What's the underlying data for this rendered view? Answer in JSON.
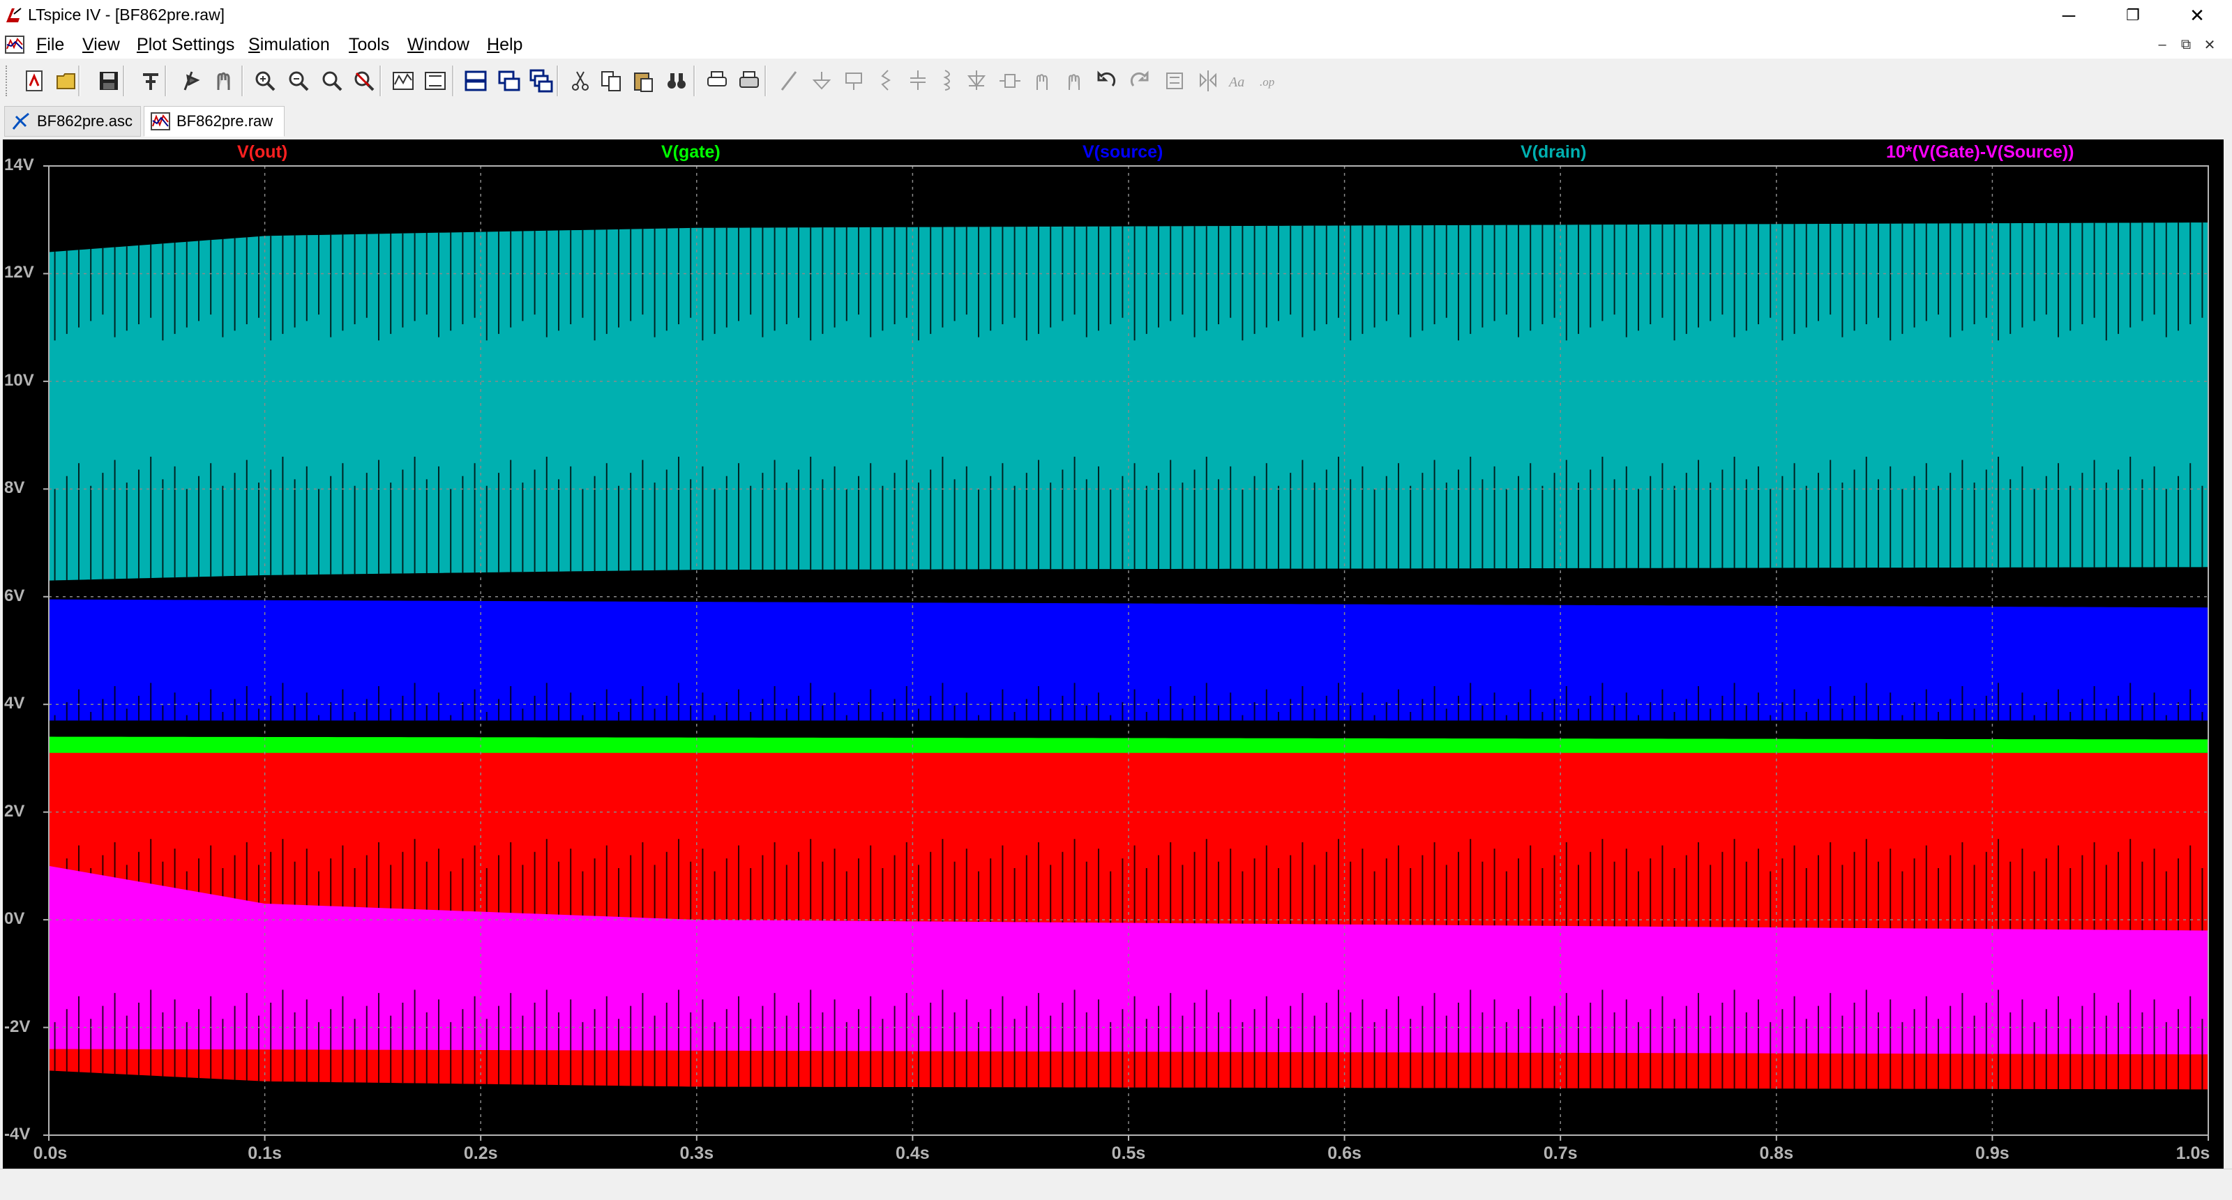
{
  "window": {
    "title": "LTspice IV - [BF862pre.raw]",
    "minimize_glyph": "─",
    "restore_glyph": "❐",
    "close_glyph": "✕"
  },
  "menu": {
    "items": [
      "File",
      "View",
      "Plot Settings",
      "Simulation",
      "Tools",
      "Window",
      "Help"
    ],
    "mdi_minimize": "–",
    "mdi_restore": "⧉",
    "mdi_close": "✕"
  },
  "toolbar": {
    "buttons": [
      "new-schematic-icon",
      "open-icon",
      "save-icon",
      "control-panel-icon",
      "run-icon",
      "halt-icon",
      "zoom-in-icon",
      "zoom-out-icon",
      "zoom-fit-icon",
      "zoom-cancel-icon",
      "autorange-icon",
      "manual-limits-icon",
      "tile-horizontal-icon",
      "tile-vertical-icon",
      "cascade-icon",
      "cut-icon",
      "copy-icon",
      "paste-icon",
      "find-icon",
      "print-preview-icon",
      "print-icon",
      "wire-icon",
      "ground-icon",
      "label-net-icon",
      "resistor-icon",
      "capacitor-icon",
      "inductor-icon",
      "diode-icon",
      "component-icon",
      "move-icon",
      "drag-icon",
      "undo-icon",
      "redo-icon",
      "rotate-icon",
      "mirror-icon",
      "text-icon",
      "spice-directive-icon"
    ]
  },
  "tabs": [
    {
      "label": "BF862pre.asc",
      "icon": "schematic-icon",
      "active": false
    },
    {
      "label": "BF862pre.raw",
      "icon": "waveform-icon",
      "active": true
    }
  ],
  "plot": {
    "background": "#000000",
    "trace_labels": [
      {
        "text": "V(out)",
        "color": "#ff2020"
      },
      {
        "text": "V(gate)",
        "color": "#00ff00"
      },
      {
        "text": "V(source)",
        "color": "#0000ff"
      },
      {
        "text": "V(drain)",
        "color": "#00b0b0"
      },
      {
        "text": "10*(V(Gate)-V(Source))",
        "color": "#ff00ff"
      }
    ],
    "y_ticks": [
      "14V",
      "12V",
      "10V",
      "8V",
      "6V",
      "4V",
      "2V",
      "0V",
      "-2V",
      "-4V"
    ],
    "x_ticks": [
      "0.0s",
      "0.1s",
      "0.2s",
      "0.3s",
      "0.4s",
      "0.5s",
      "0.6s",
      "0.7s",
      "0.8s",
      "0.9s",
      "1.0s"
    ]
  },
  "chart_data": {
    "type": "line",
    "title": "",
    "xlabel": "",
    "ylabel": "",
    "xlim": [
      0.0,
      1.0
    ],
    "ylim": [
      -4,
      14
    ],
    "grid": true,
    "series": [
      {
        "name": "V(drain)",
        "color": "#00b0b0",
        "envelope": {
          "upper": [
            [
              0.0,
              12.4
            ],
            [
              0.1,
              12.7
            ],
            [
              0.3,
              12.85
            ],
            [
              1.0,
              12.95
            ]
          ],
          "lower": [
            [
              0.0,
              6.3
            ],
            [
              0.1,
              6.4
            ],
            [
              0.3,
              6.5
            ],
            [
              1.0,
              6.55
            ]
          ],
          "spike_low": 8.3,
          "spike_high": 11.0
        }
      },
      {
        "name": "V(source)",
        "color": "#0000ff",
        "envelope": {
          "upper": [
            [
              0.0,
              5.95
            ],
            [
              1.0,
              5.8
            ]
          ],
          "lower": [
            [
              0.0,
              3.7
            ],
            [
              1.0,
              3.7
            ]
          ],
          "spike_low": 4.1
        }
      },
      {
        "name": "V(gate)",
        "color": "#00ff00",
        "envelope": {
          "upper": [
            [
              0.0,
              3.4
            ],
            [
              1.0,
              3.35
            ]
          ],
          "lower": [
            [
              0.0,
              3.1
            ],
            [
              1.0,
              3.1
            ]
          ]
        }
      },
      {
        "name": "V(out)",
        "color": "#ff0000",
        "envelope": {
          "upper": [
            [
              0.0,
              3.2
            ],
            [
              1.0,
              3.1
            ]
          ],
          "lower": [
            [
              0.0,
              -2.8
            ],
            [
              0.1,
              -3.0
            ],
            [
              0.3,
              -3.1
            ],
            [
              1.0,
              -3.15
            ]
          ],
          "spike_low": 1.2
        }
      },
      {
        "name": "10*(V(Gate)-V(Source))",
        "color": "#ff00ff",
        "envelope": {
          "upper": [
            [
              0.0,
              1.0
            ],
            [
              0.1,
              0.3
            ],
            [
              0.3,
              0.0
            ],
            [
              1.0,
              -0.2
            ]
          ],
          "lower": [
            [
              0.0,
              -2.4
            ],
            [
              1.0,
              -2.5
            ]
          ],
          "spike_low": -1.6
        }
      }
    ]
  }
}
